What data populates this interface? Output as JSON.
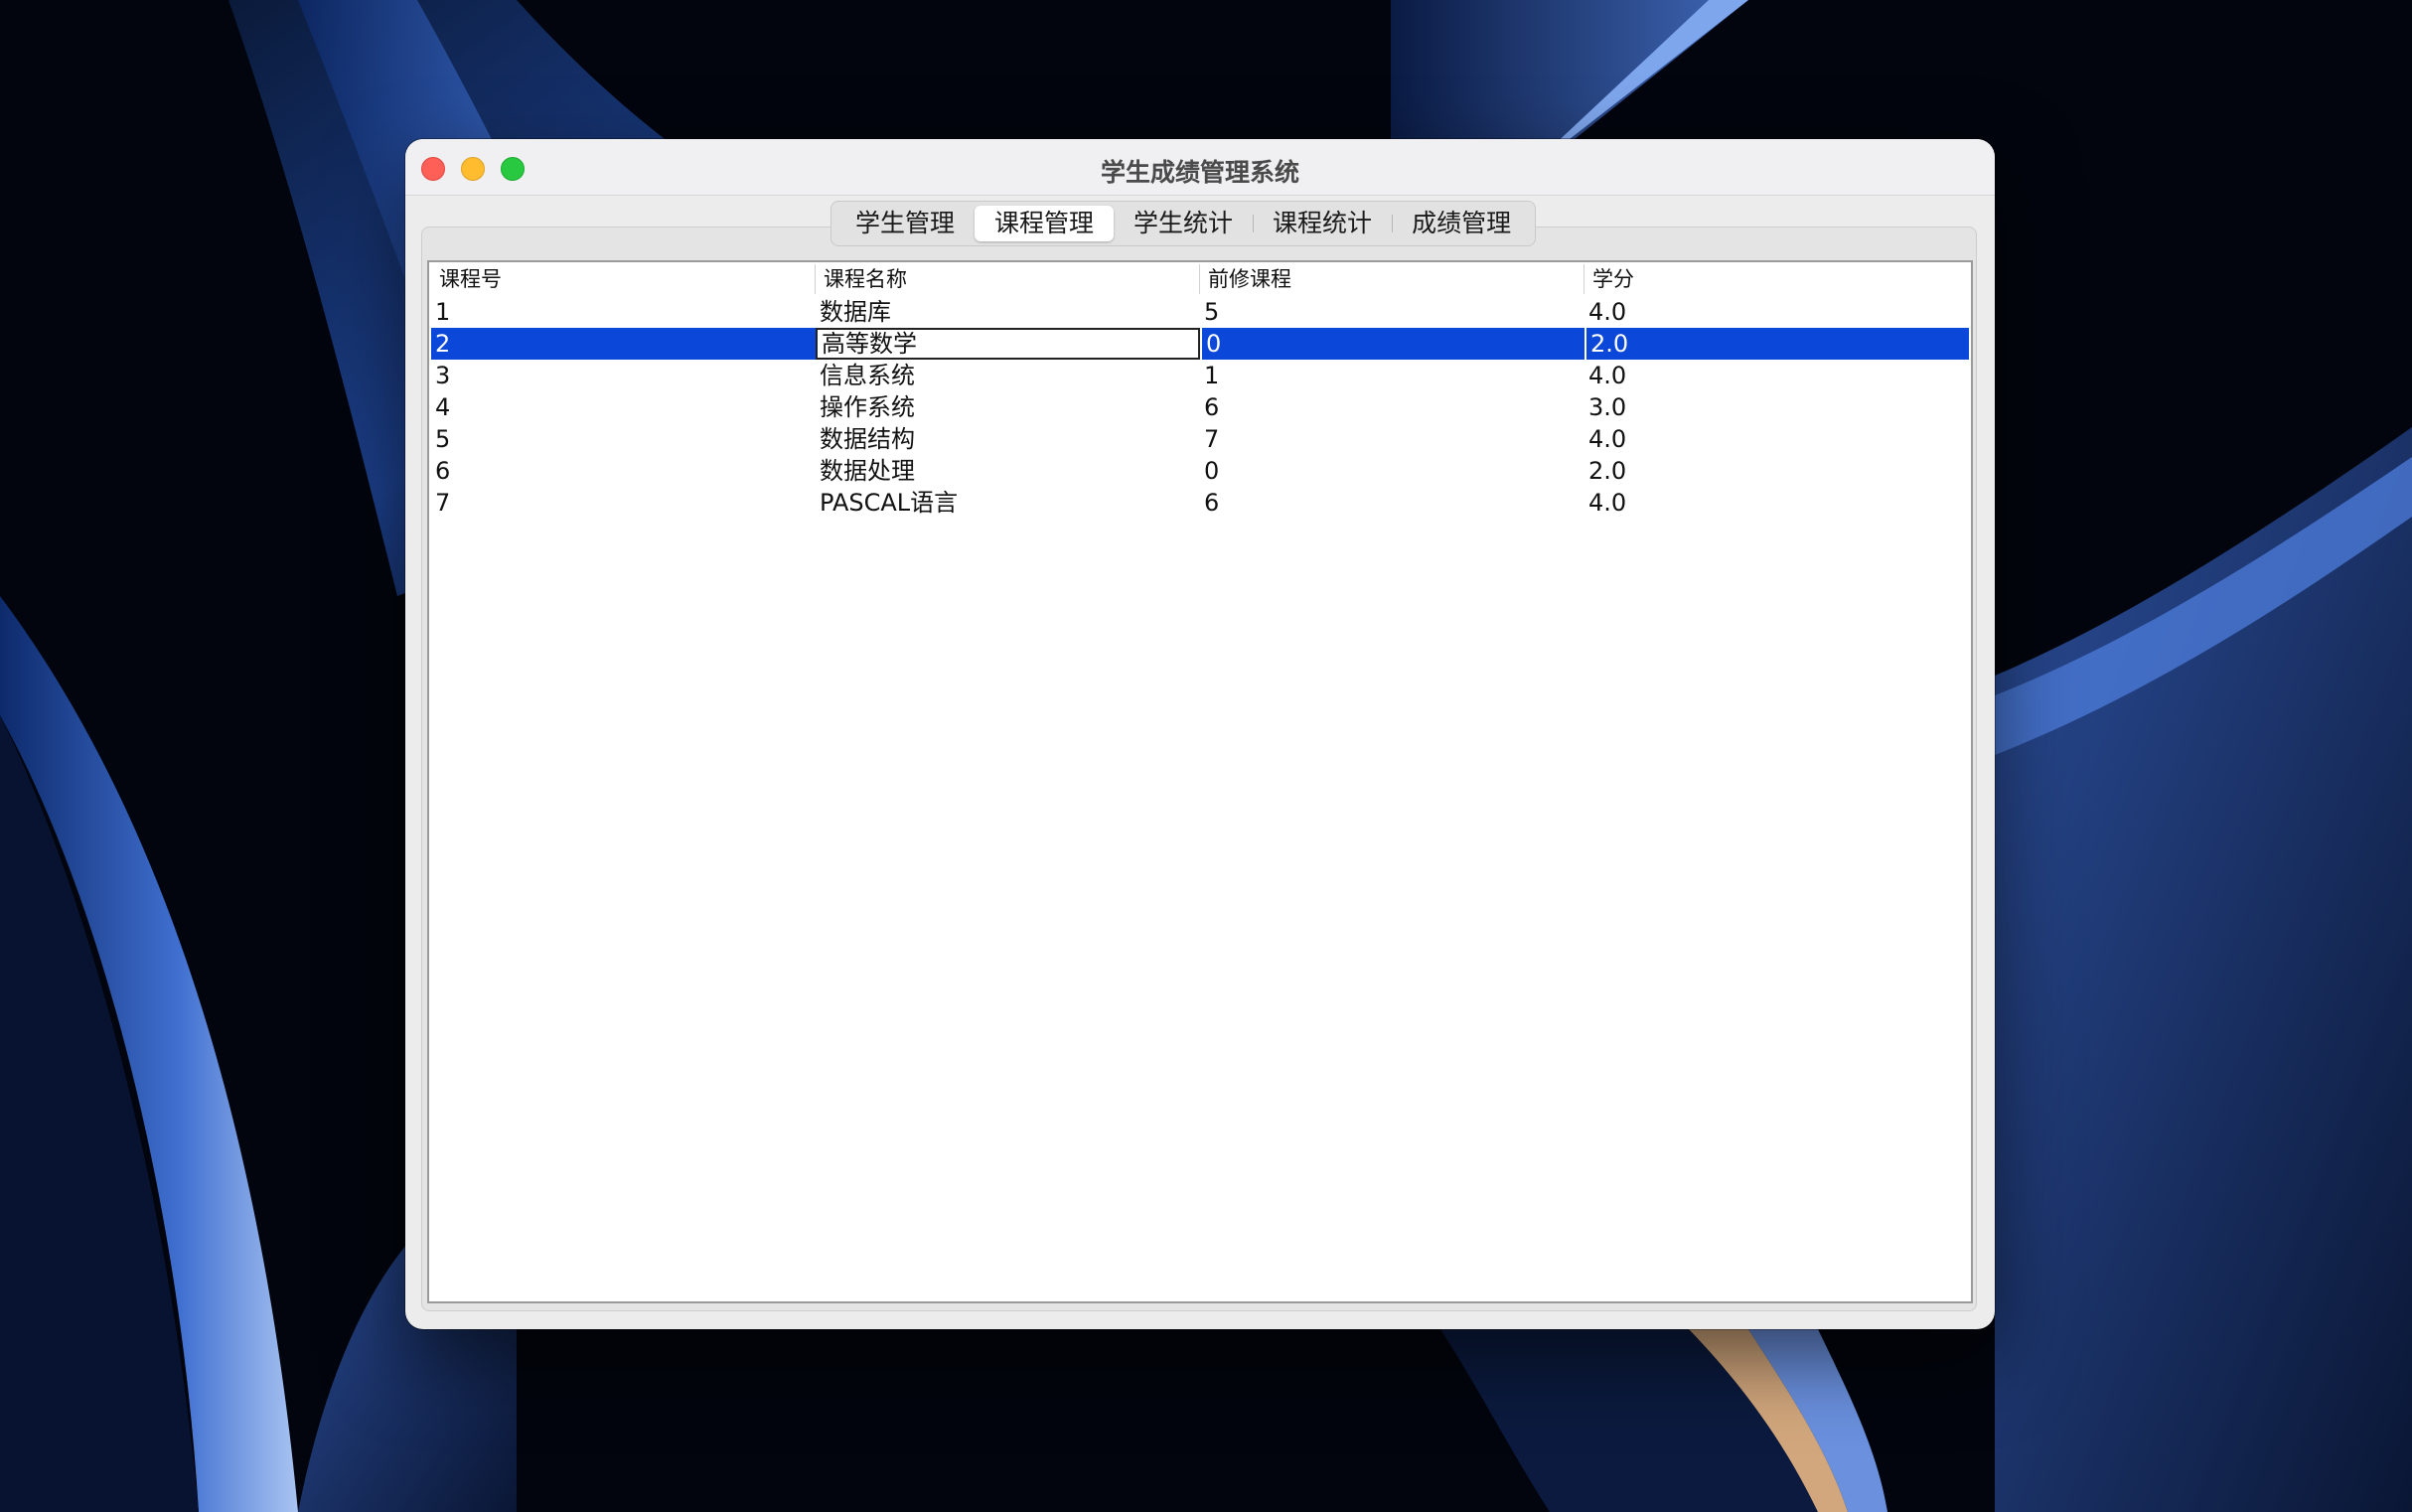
{
  "window": {
    "title": "学生成绩管理系统"
  },
  "tabs": [
    {
      "label": "学生管理",
      "active": false
    },
    {
      "label": "课程管理",
      "active": true
    },
    {
      "label": "学生统计",
      "active": false
    },
    {
      "label": "课程统计",
      "active": false
    },
    {
      "label": "成绩管理",
      "active": false
    }
  ],
  "table": {
    "columns": [
      "课程号",
      "课程名称",
      "前修课程",
      "学分"
    ],
    "rows": [
      [
        "1",
        "数据库",
        "5",
        "4.0"
      ],
      [
        "2",
        "高等数学",
        "0",
        "2.0"
      ],
      [
        "3",
        "信息系统",
        "1",
        "4.0"
      ],
      [
        "4",
        "操作系统",
        "6",
        "3.0"
      ],
      [
        "5",
        "数据结构",
        "7",
        "4.0"
      ],
      [
        "6",
        "数据处理",
        "0",
        "2.0"
      ],
      [
        "7",
        "PASCAL语言",
        "6",
        "4.0"
      ]
    ],
    "selected_row": 1,
    "editing_column": 1
  },
  "colors": {
    "selection": "#0b47d8",
    "close": "#fe5f57",
    "minimize": "#febc2e",
    "maximize": "#28c840"
  }
}
